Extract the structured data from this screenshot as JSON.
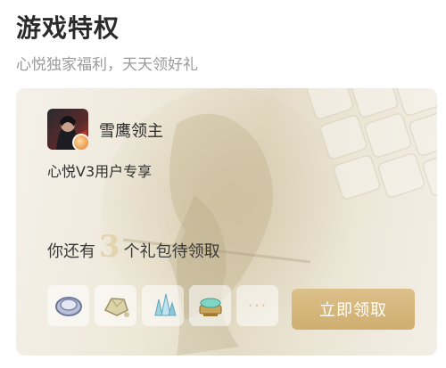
{
  "section": {
    "title": "游戏特权",
    "subtitle": "心悦独家福利，天天领好礼"
  },
  "card": {
    "game_name": "雪鹰领主",
    "vip_text": "心悦V3用户专享",
    "gift_prefix": "你还有",
    "gift_count": "3",
    "gift_suffix": "个礼包待领取",
    "more_label": "···",
    "claim_label": "立即领取",
    "items": [
      {
        "icon": "silver-coin-icon"
      },
      {
        "icon": "ore-icon"
      },
      {
        "icon": "crystal-icon"
      },
      {
        "icon": "jade-chest-icon"
      }
    ]
  },
  "colors": {
    "accent_gold": "#d6b77c",
    "count_gold": "#e2d4ad",
    "title_text": "#2b2b2b",
    "subtitle_text": "#9a9a9a"
  }
}
